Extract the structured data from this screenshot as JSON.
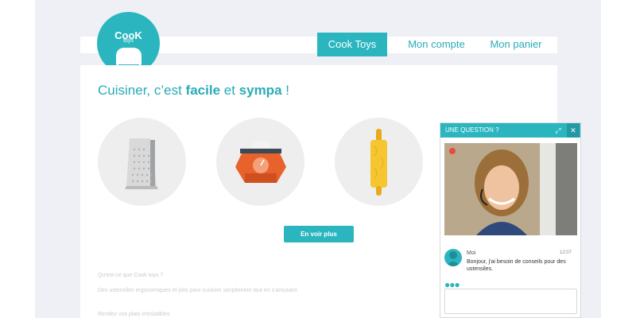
{
  "logo": {
    "title": "CooK",
    "subtitle": "toys"
  },
  "nav": {
    "items": [
      {
        "label": "Cook Toys",
        "active": true
      },
      {
        "label": "Mon compte",
        "active": false
      },
      {
        "label": "Mon panier",
        "active": false
      }
    ]
  },
  "hero": {
    "headline_pre": "Cuisiner, c’est ",
    "headline_word1": "facile",
    "headline_mid": " et ",
    "headline_word2": "sympa",
    "headline_post": " !"
  },
  "products": [
    {
      "icon": "grater-icon"
    },
    {
      "icon": "kitchen-scale-icon"
    },
    {
      "icon": "rolling-pin-icon"
    }
  ],
  "cta": {
    "label": "En voir plus"
  },
  "about": {
    "question": "Qu'est-ce que Cook toys ?",
    "description": "Des ustensiles ergonomiques et jolis pour cuisiner simplement tout en s'amusant.",
    "next_heading": "Rendez vos plats irrésistibles"
  },
  "chat": {
    "title": "UNE QUESTION ?",
    "expand_icon": "expand-icon",
    "close_icon": "close-icon",
    "message": {
      "author": "Moi",
      "time": "12:07",
      "text": "Bonjour, j'ai besoin de conseils pour des ustensiles."
    }
  },
  "colors": {
    "accent": "#2bb6bf",
    "backdrop": "#eef0f6",
    "record": "#e94b3c"
  }
}
